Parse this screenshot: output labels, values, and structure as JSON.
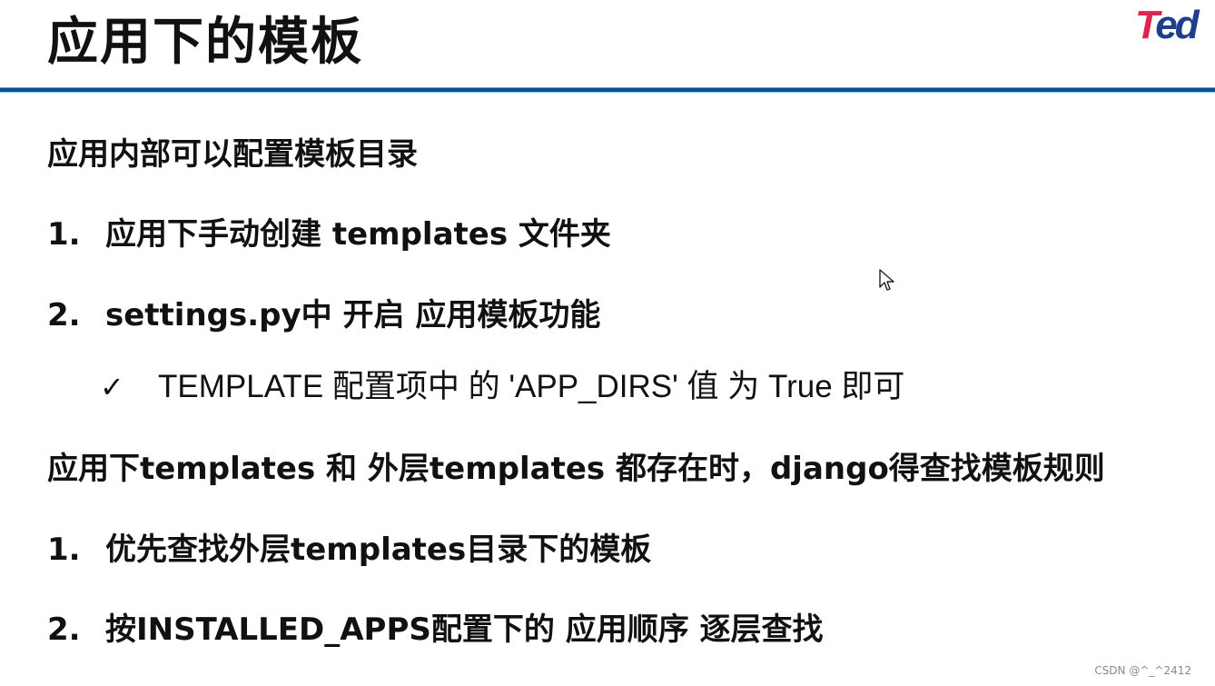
{
  "slide": {
    "title": "应用下的模板",
    "logo": {
      "part1": "T",
      "part2": "ed"
    },
    "section1": {
      "heading": "应用内部可以配置模板目录",
      "items": [
        {
          "num": "1.",
          "text": "应用下手动创建 templates 文件夹"
        },
        {
          "num": "2.",
          "text": "settings.py中 开启 应用模板功能"
        }
      ],
      "sub_item": {
        "icon": "✓",
        "text": "TEMPLATE 配置项中 的 'APP_DIRS' 值 为 True 即可"
      }
    },
    "section2": {
      "heading": "应用下templates 和 外层templates 都存在时，django得查找模板规则",
      "items": [
        {
          "num": "1.",
          "text": "优先查找外层templates目录下的模板"
        },
        {
          "num": "2.",
          "text": "按INSTALLED_APPS配置下的 应用顺序 逐层查找"
        }
      ]
    },
    "watermark": "CSDN @^_^2412",
    "colors": {
      "divider": "#0a4e96",
      "logo_red": "#e0244f",
      "logo_blue": "#1f3f8c"
    }
  }
}
